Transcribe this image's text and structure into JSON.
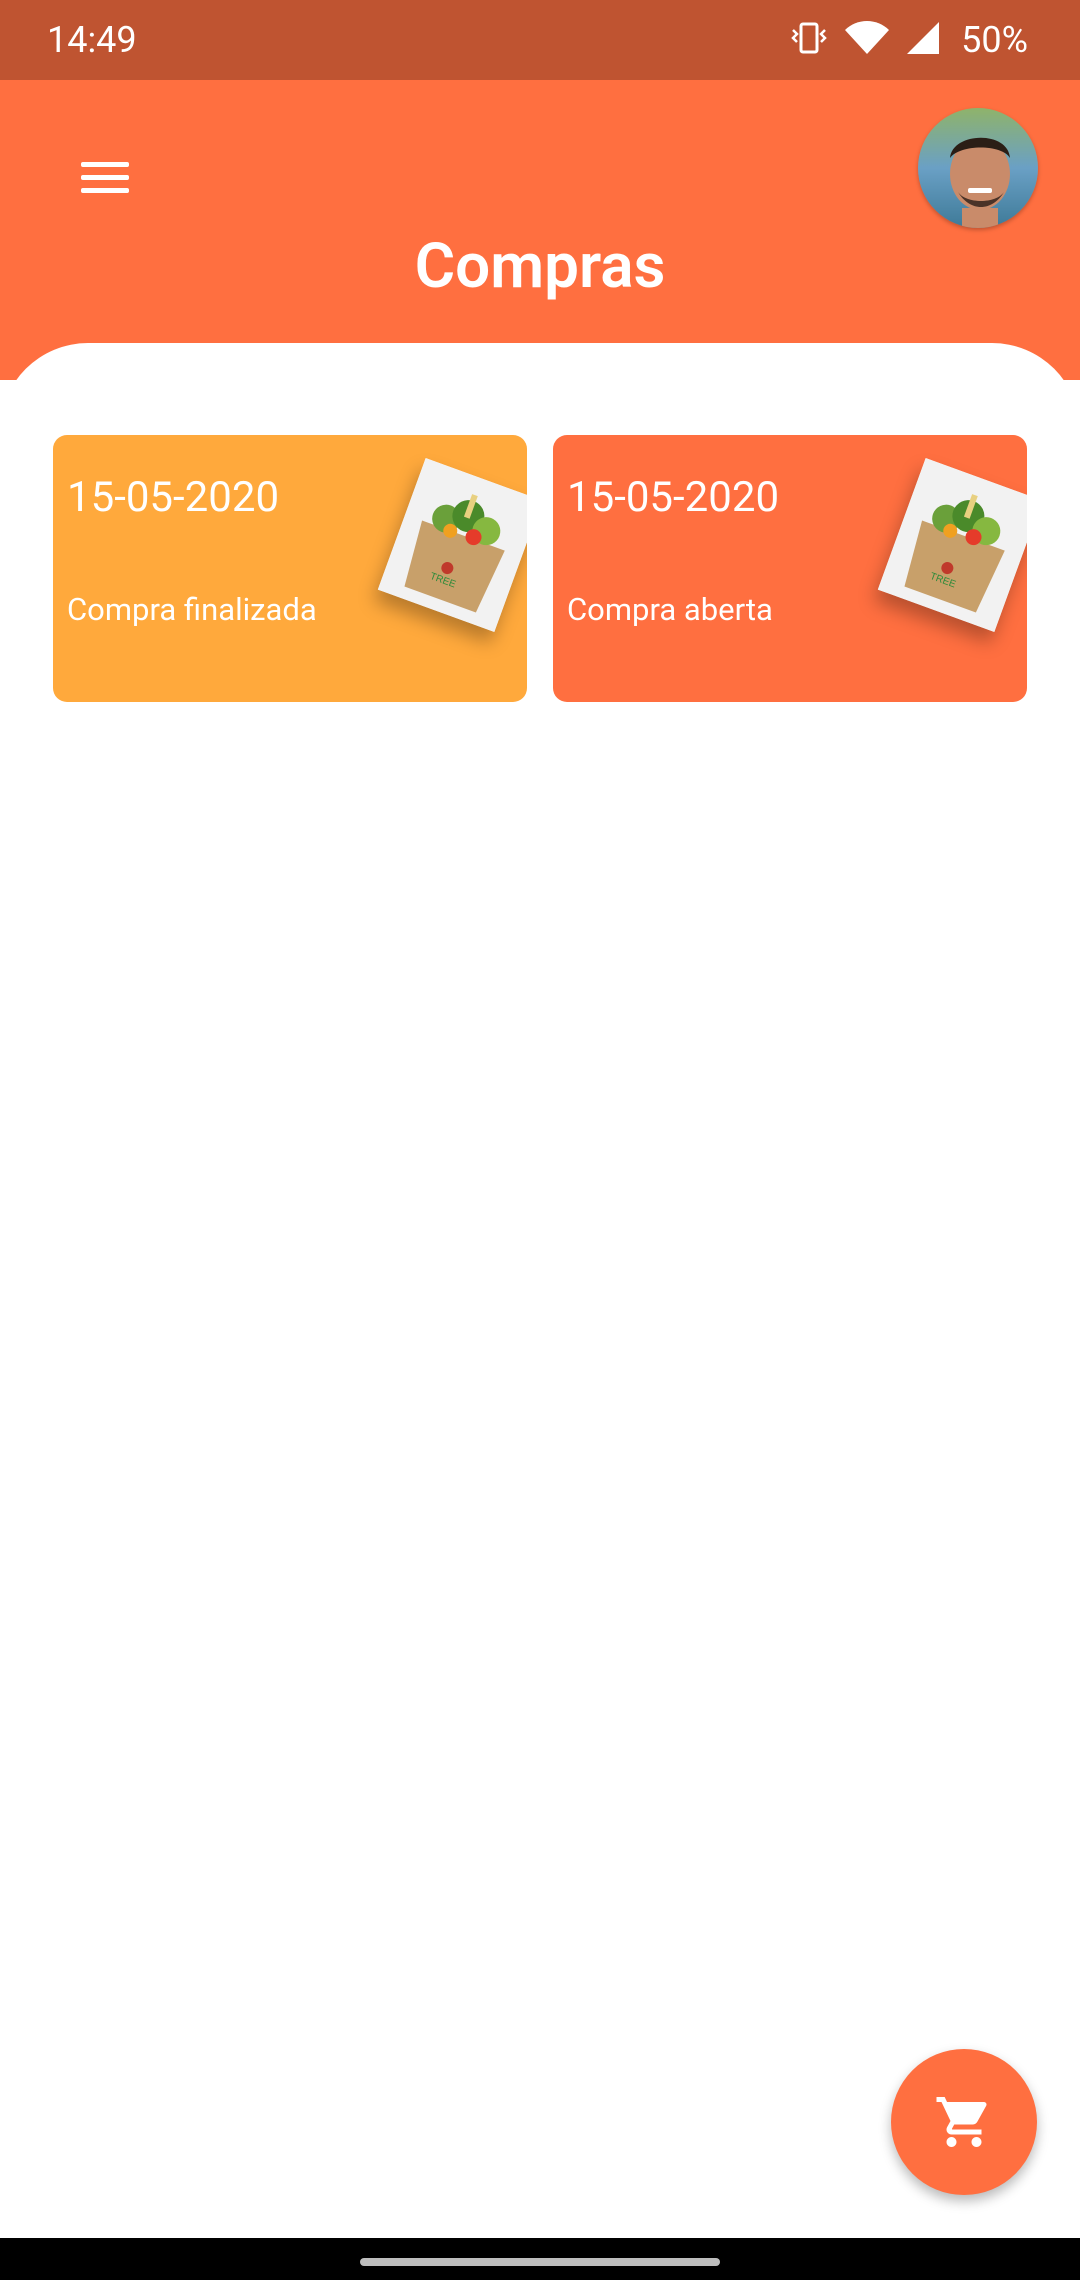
{
  "status_bar": {
    "time": "14:49",
    "battery": "50%",
    "icons": [
      "vibrate-icon",
      "wifi-icon",
      "signal-icon"
    ]
  },
  "header": {
    "title": "Compras",
    "menu_icon": "menu-icon",
    "avatar_alt": "user-avatar"
  },
  "purchases": [
    {
      "date": "15-05-2020",
      "status": "Compra finalizada",
      "color": "#ffa93c",
      "image": "grocery-bag"
    },
    {
      "date": "15-05-2020",
      "status": "Compra aberta",
      "color": "#ff6f40",
      "image": "grocery-bag"
    }
  ],
  "fab": {
    "icon": "shopping-cart-icon"
  },
  "colors": {
    "primary": "#ff6f40",
    "status_bar": "#bf5431",
    "finished": "#ffa93c"
  }
}
